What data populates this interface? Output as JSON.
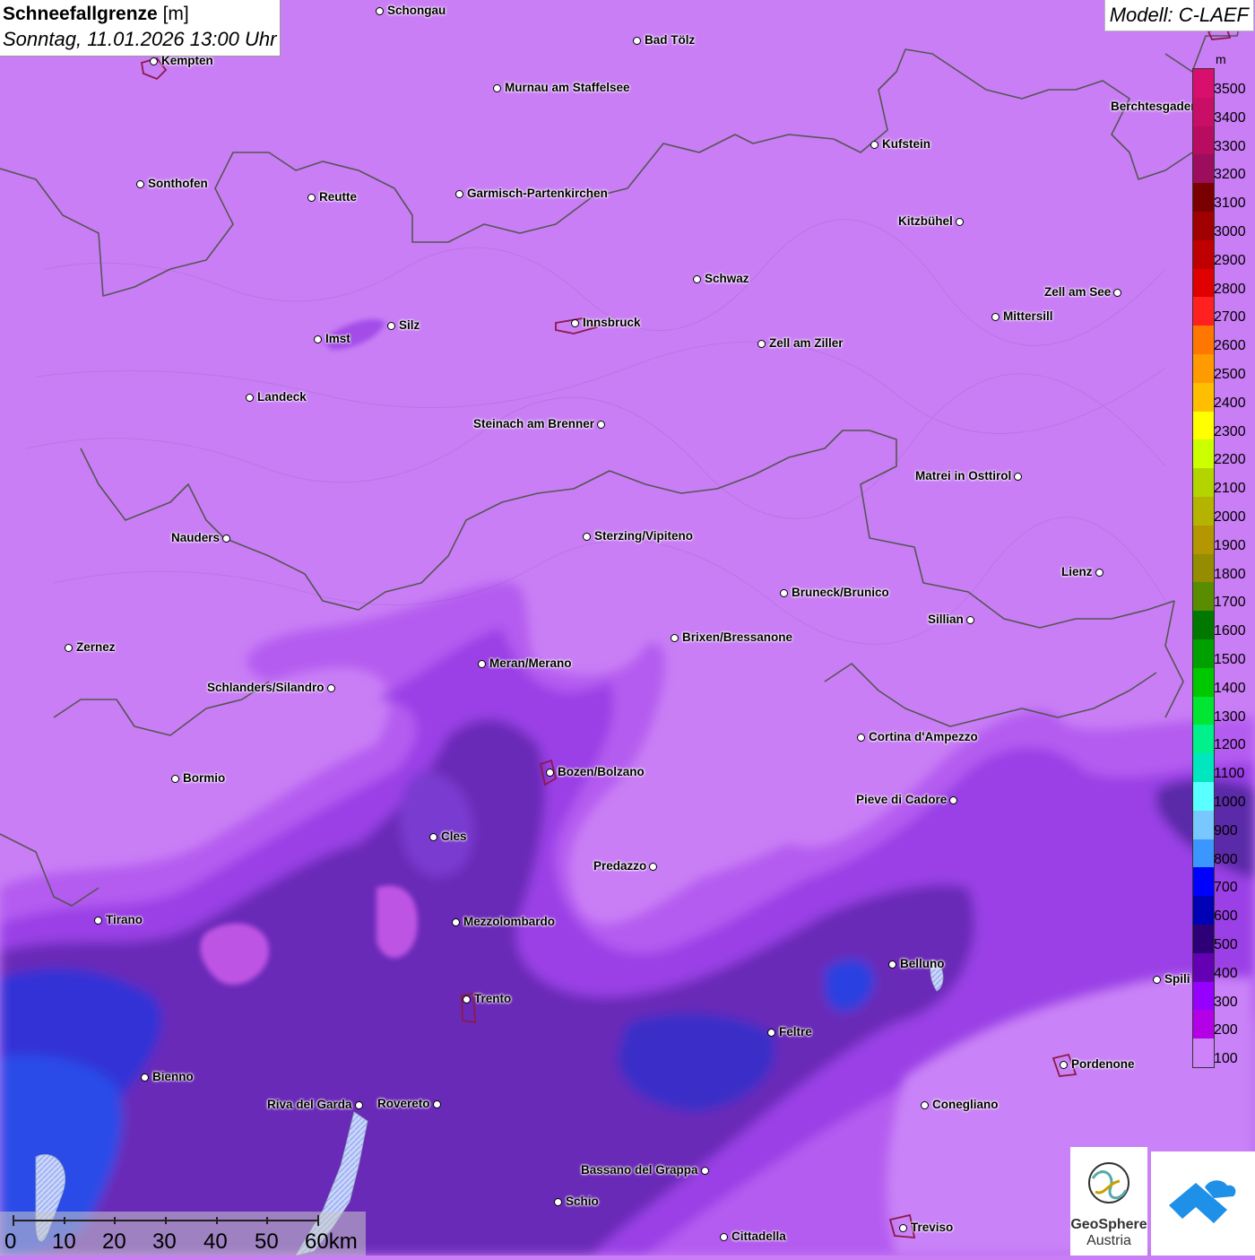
{
  "header": {
    "title_bold": "Schneefallgrenze",
    "title_unit": "[m]",
    "subtitle": "Sonntag, 11.01.2026 13:00 Uhr",
    "model": "Modell: C-LAEF"
  },
  "legend": {
    "unit": "m",
    "entries": [
      {
        "label": "3500",
        "color": "#d80f6c"
      },
      {
        "label": "3400",
        "color": "#c80e66"
      },
      {
        "label": "3300",
        "color": "#b80c60"
      },
      {
        "label": "3200",
        "color": "#9c0d5e"
      },
      {
        "label": "3100",
        "color": "#7a0000"
      },
      {
        "label": "3000",
        "color": "#a00000"
      },
      {
        "label": "2900",
        "color": "#c00000"
      },
      {
        "label": "2800",
        "color": "#e00000"
      },
      {
        "label": "2700",
        "color": "#ff2020"
      },
      {
        "label": "2600",
        "color": "#ff7700"
      },
      {
        "label": "2500",
        "color": "#ff9a00"
      },
      {
        "label": "2400",
        "color": "#ffbf00"
      },
      {
        "label": "2300",
        "color": "#ffff00"
      },
      {
        "label": "2200",
        "color": "#ccff00"
      },
      {
        "label": "2100",
        "color": "#b4d400"
      },
      {
        "label": "2000",
        "color": "#b4b400"
      },
      {
        "label": "1900",
        "color": "#b49600"
      },
      {
        "label": "1800",
        "color": "#968c00"
      },
      {
        "label": "1700",
        "color": "#5a8c00"
      },
      {
        "label": "1600",
        "color": "#007800"
      },
      {
        "label": "1500",
        "color": "#00a000"
      },
      {
        "label": "1400",
        "color": "#00c800"
      },
      {
        "label": "1300",
        "color": "#00e632"
      },
      {
        "label": "1200",
        "color": "#00f08c"
      },
      {
        "label": "1100",
        "color": "#00e6be"
      },
      {
        "label": "1000",
        "color": "#5affff"
      },
      {
        "label": "900",
        "color": "#78c8ff"
      },
      {
        "label": "800",
        "color": "#3c96ff"
      },
      {
        "label": "700",
        "color": "#0000ff"
      },
      {
        "label": "600",
        "color": "#0000b4"
      },
      {
        "label": "500",
        "color": "#2d0078"
      },
      {
        "label": "400",
        "color": "#6400b4"
      },
      {
        "label": "300",
        "color": "#9600ff"
      },
      {
        "label": "200",
        "color": "#b400e6"
      },
      {
        "label": "100",
        "color": "#cd82fa"
      }
    ]
  },
  "cities": [
    {
      "name": "Schongau",
      "side": "r"
    },
    {
      "name": "Bad Tölz",
      "side": "r"
    },
    {
      "name": "Kempten",
      "side": "r"
    },
    {
      "name": "Murnau am Staffelsee",
      "side": "r"
    },
    {
      "name": "Berchtesgaden",
      "side": "l"
    },
    {
      "name": "Kufstein",
      "side": "r"
    },
    {
      "name": "Sonthofen",
      "side": "r"
    },
    {
      "name": "Reutte",
      "side": "r"
    },
    {
      "name": "Garmisch-Partenkirchen",
      "side": "r"
    },
    {
      "name": "Kitzbühel",
      "side": "l"
    },
    {
      "name": "Schwaz",
      "side": "r"
    },
    {
      "name": "Zell am See",
      "side": "l"
    },
    {
      "name": "Mittersill",
      "side": "r"
    },
    {
      "name": "Silz",
      "side": "r"
    },
    {
      "name": "Innsbruck",
      "side": "r"
    },
    {
      "name": "Imst",
      "side": "r"
    },
    {
      "name": "Zell am Ziller",
      "side": "r"
    },
    {
      "name": "Landeck",
      "side": "r"
    },
    {
      "name": "Steinach am Brenner",
      "side": "l"
    },
    {
      "name": "Matrei in Osttirol",
      "side": "l"
    },
    {
      "name": "Nauders",
      "side": "l"
    },
    {
      "name": "Sterzing/Vipiteno",
      "side": "r"
    },
    {
      "name": "Lienz",
      "side": "l"
    },
    {
      "name": "Bruneck/Brunico",
      "side": "r"
    },
    {
      "name": "Sillian",
      "side": "l"
    },
    {
      "name": "Zernez",
      "side": "r"
    },
    {
      "name": "Brixen/Bressanone",
      "side": "r"
    },
    {
      "name": "Meran/Merano",
      "side": "r"
    },
    {
      "name": "Schlanders/Silandro",
      "side": "l"
    },
    {
      "name": "Cortina d'Ampezzo",
      "side": "r"
    },
    {
      "name": "Bozen/Bolzano",
      "side": "r"
    },
    {
      "name": "Bormio",
      "side": "r"
    },
    {
      "name": "Pieve di Cadore",
      "side": "l"
    },
    {
      "name": "Cles",
      "side": "r"
    },
    {
      "name": "Predazzo",
      "side": "l"
    },
    {
      "name": "Tirano",
      "side": "r"
    },
    {
      "name": "Mezzolombardo",
      "side": "r"
    },
    {
      "name": "Belluno",
      "side": "r"
    },
    {
      "name": "Spili",
      "side": "r"
    },
    {
      "name": "Trento",
      "side": "r"
    },
    {
      "name": "Feltre",
      "side": "r"
    },
    {
      "name": "Pordenone",
      "side": "r"
    },
    {
      "name": "Bienno",
      "side": "r"
    },
    {
      "name": "Riva del Garda",
      "side": "l"
    },
    {
      "name": "Rovereto",
      "side": "l"
    },
    {
      "name": "Conegliano",
      "side": "r"
    },
    {
      "name": "Bassano del Grappa",
      "side": "l"
    },
    {
      "name": "Schio",
      "side": "r"
    },
    {
      "name": "Treviso",
      "side": "r"
    },
    {
      "name": "Cittadella",
      "side": "r"
    }
  ],
  "scale": {
    "labels": [
      "0",
      "10",
      "20",
      "30",
      "40",
      "50",
      "60km"
    ]
  },
  "logos": {
    "geosphere_line1": "GeoSphere",
    "geosphere_line2": "Austria"
  }
}
